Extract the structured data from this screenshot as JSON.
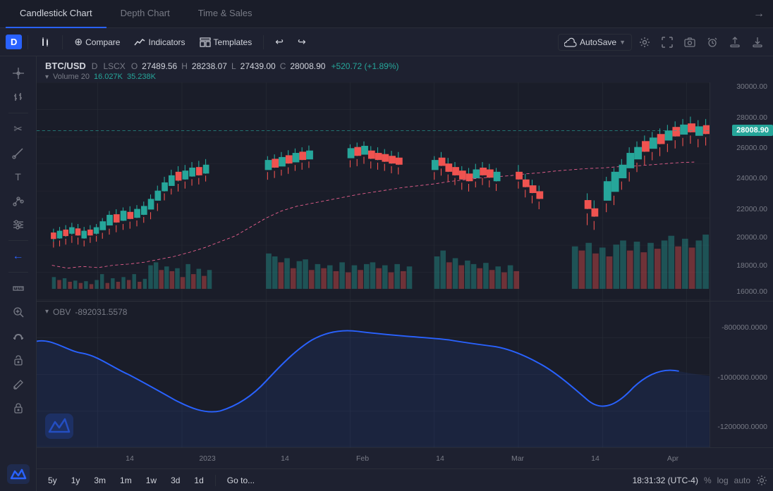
{
  "tabs": [
    {
      "label": "Candlestick Chart",
      "active": true
    },
    {
      "label": "Depth Chart",
      "active": false
    },
    {
      "label": "Time & Sales",
      "active": false
    }
  ],
  "toolbar": {
    "timeframe": "D",
    "indicators_icon": "indi",
    "indicators_label": "Indicators",
    "templates_label": "Templates",
    "compare_label": "Compare",
    "autosave_label": "AutoSave",
    "undo_icon": "↩",
    "redo_icon": "↪"
  },
  "chart": {
    "pair": "BTC/USD",
    "timeframe": "D",
    "exchange": "LSCX",
    "open_label": "O",
    "open_val": "27489.56",
    "high_label": "H",
    "high_val": "28238.07",
    "low_label": "L",
    "low_val": "27439.00",
    "close_label": "C",
    "close_val": "28008.90",
    "change": "+520.72 (+1.89%)",
    "volume_label": "Volume 20",
    "volume_val1": "16.027K",
    "volume_val2": "35.238K",
    "price_highlight": "28008.90"
  },
  "obv": {
    "label": "OBV",
    "value": "-892031.5578"
  },
  "yaxis_price": [
    "30000.00",
    "28000.00",
    "26000.00",
    "24000.00",
    "22000.00",
    "20000.00",
    "18000.00",
    "16000.00"
  ],
  "yaxis_obv": [
    "-800000.0000",
    "-1000000.0000",
    "-1200000.0000"
  ],
  "xaxis_labels": [
    "14",
    "2023",
    "14",
    "Feb",
    "14",
    "Mar",
    "14",
    "Apr"
  ],
  "bottom": {
    "periods": [
      "5y",
      "1y",
      "3m",
      "1m",
      "1w",
      "3d",
      "1d"
    ],
    "goto_label": "Go to...",
    "time": "18:31:32 (UTC-4)",
    "pct_label": "%",
    "log_label": "log",
    "auto_label": "auto"
  },
  "left_tools": [
    "crosshair",
    "bar-chart",
    "scissors",
    "pen",
    "text",
    "node",
    "settings",
    "arrow-left",
    "ruler",
    "zoom",
    "magnet",
    "lock-open",
    "pencil",
    "lock"
  ]
}
